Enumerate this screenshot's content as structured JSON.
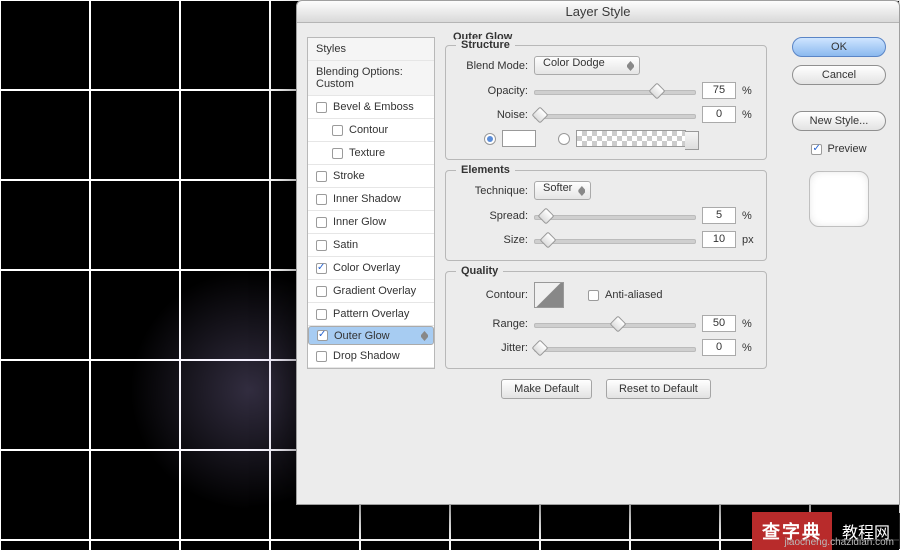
{
  "dialog": {
    "title": "Layer Style",
    "current_section": "Outer Glow"
  },
  "sidebar": {
    "styles_header": "Styles",
    "blending_header": "Blending Options: Custom",
    "items": [
      {
        "label": "Bevel & Emboss",
        "checked": false,
        "sub": false
      },
      {
        "label": "Contour",
        "checked": false,
        "sub": true
      },
      {
        "label": "Texture",
        "checked": false,
        "sub": true
      },
      {
        "label": "Stroke",
        "checked": false,
        "sub": false
      },
      {
        "label": "Inner Shadow",
        "checked": false,
        "sub": false
      },
      {
        "label": "Inner Glow",
        "checked": false,
        "sub": false
      },
      {
        "label": "Satin",
        "checked": false,
        "sub": false
      },
      {
        "label": "Color Overlay",
        "checked": true,
        "sub": false
      },
      {
        "label": "Gradient Overlay",
        "checked": false,
        "sub": false
      },
      {
        "label": "Pattern Overlay",
        "checked": false,
        "sub": false
      },
      {
        "label": "Outer Glow",
        "checked": true,
        "sub": false,
        "selected": true
      },
      {
        "label": "Drop Shadow",
        "checked": false,
        "sub": false
      }
    ]
  },
  "structure": {
    "legend": "Structure",
    "blend_mode_label": "Blend Mode:",
    "blend_mode_value": "Color Dodge",
    "opacity_label": "Opacity:",
    "opacity_value": "75",
    "opacity_unit": "%",
    "noise_label": "Noise:",
    "noise_value": "0",
    "noise_unit": "%"
  },
  "elements": {
    "legend": "Elements",
    "technique_label": "Technique:",
    "technique_value": "Softer",
    "spread_label": "Spread:",
    "spread_value": "5",
    "spread_unit": "%",
    "size_label": "Size:",
    "size_value": "10",
    "size_unit": "px"
  },
  "quality": {
    "legend": "Quality",
    "contour_label": "Contour:",
    "anti_aliased_label": "Anti-aliased",
    "anti_aliased_checked": false,
    "range_label": "Range:",
    "range_value": "50",
    "range_unit": "%",
    "jitter_label": "Jitter:",
    "jitter_value": "0",
    "jitter_unit": "%"
  },
  "footer": {
    "make_default": "Make Default",
    "reset": "Reset to Default"
  },
  "right": {
    "ok": "OK",
    "cancel": "Cancel",
    "new_style": "New Style...",
    "preview": "Preview"
  },
  "watermark": {
    "badge": "查字典",
    "text": "教程网",
    "url": "jiaocheng.chazidian.com"
  }
}
